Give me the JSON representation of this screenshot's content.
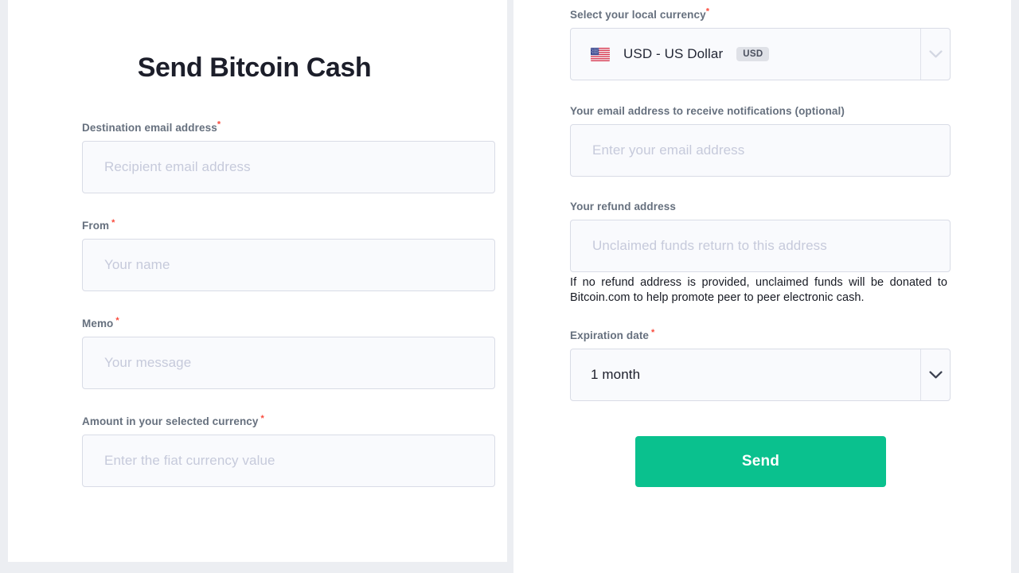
{
  "page": {
    "title": "Send Bitcoin Cash"
  },
  "form_left": {
    "fields": [
      {
        "label": "Destination email address",
        "required": true,
        "required_spaced": false,
        "placeholder": "Recipient email address",
        "value": ""
      },
      {
        "label": "From",
        "required": true,
        "required_spaced": true,
        "placeholder": "Your name",
        "value": ""
      },
      {
        "label": "Memo",
        "required": true,
        "required_spaced": true,
        "placeholder": "Your message",
        "value": ""
      },
      {
        "label": "Amount in your selected currency",
        "required": true,
        "required_spaced": true,
        "placeholder": "Enter the fiat currency value",
        "value": ""
      }
    ]
  },
  "form_right": {
    "currency": {
      "label": "Select your local currency",
      "required": true,
      "selected_text": "USD - US Dollar",
      "selected_code": "USD",
      "flag_icon": "us-flag-icon",
      "chevron_icon": "chevron-down-icon"
    },
    "notification_email": {
      "label": "Your email address to receive notifications (optional)",
      "required": false,
      "placeholder": "Enter your email address",
      "value": ""
    },
    "refund_address": {
      "label": "Your refund address",
      "required": false,
      "placeholder": "Unclaimed funds return to this address",
      "value": "",
      "helper_text": "If no refund address is provided, unclaimed funds will be donated to Bitcoin.com to help promote peer to peer electronic cash."
    },
    "expiration": {
      "label": "Expiration date",
      "required": true,
      "selected_text": "1 month",
      "chevron_icon": "chevron-down-icon"
    },
    "submit": {
      "label": "Send"
    }
  },
  "colors": {
    "accent_green": "#0ac18e",
    "required_red": "#fa4a3c",
    "label_gray": "#66707e",
    "title_dark": "#1c1e2a",
    "input_bg": "#f9fafd",
    "input_border": "#d9dce6",
    "page_bg": "#eceef2"
  }
}
